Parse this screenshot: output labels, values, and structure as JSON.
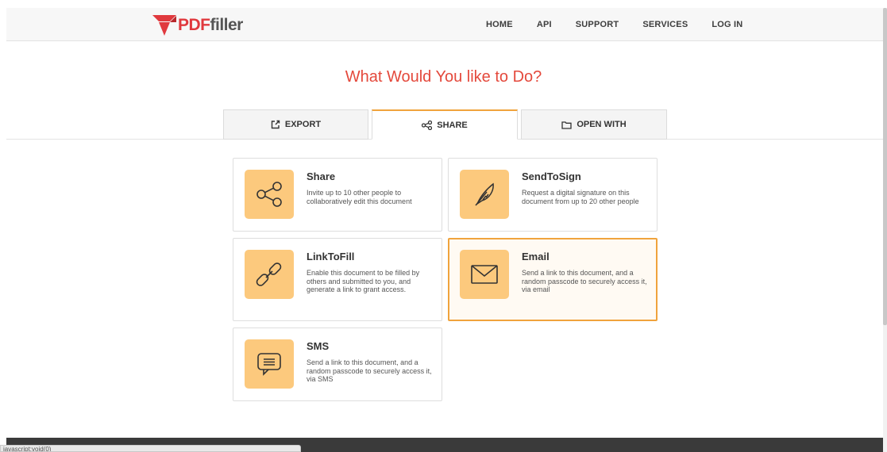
{
  "header": {
    "logo_pdf": "PDF",
    "logo_filler": "filler",
    "nav": [
      "HOME",
      "API",
      "SUPPORT",
      "SERVICES",
      "LOG IN"
    ]
  },
  "main": {
    "title": "What Would You like to Do?",
    "tabs": [
      {
        "label": "EXPORT",
        "icon": "export-icon"
      },
      {
        "label": "SHARE",
        "icon": "share-icon",
        "active": true
      },
      {
        "label": "OPEN WITH",
        "icon": "folder-icon"
      }
    ],
    "cards": [
      {
        "title": "Share",
        "description": "Invite up to 10 other people to collaboratively edit this document",
        "icon": "share-icon"
      },
      {
        "title": "SendToSign",
        "description": "Request a digital signature on this document from up to 20 other people",
        "icon": "feather-icon"
      },
      {
        "title": "LinkToFill",
        "description": "Enable this document to be filled by others and submitted to you, and generate a link to grant access.",
        "icon": "link-icon"
      },
      {
        "title": "Email",
        "description": "Send a link to this document, and a random passcode to securely access it, via email",
        "icon": "envelope-icon",
        "selected": true
      },
      {
        "title": "SMS",
        "description": "Send a link to this document, and a random passcode to securely access it, via SMS",
        "icon": "message-icon"
      }
    ]
  },
  "status_bar": {
    "text": "javascript:void(0)"
  },
  "colors": {
    "accent": "#e4493c",
    "icon_bg": "#fcc97d",
    "selected_border": "#f0a33c"
  }
}
